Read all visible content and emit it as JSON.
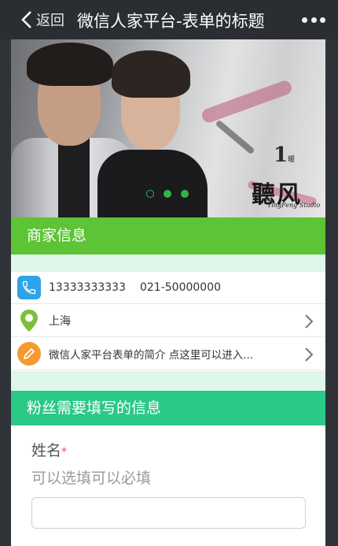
{
  "nav": {
    "back_label": "返回",
    "title": "微信人家平台-表单的标题"
  },
  "banner": {
    "studio_number": "1",
    "studio_number_suffix": "暖",
    "studio_name": "聽风",
    "studio_subtitle": "TingFeng Studio",
    "slide_count": 3,
    "active_slide": 2
  },
  "shop": {
    "header": "商家信息",
    "phone_mobile": "13333333333",
    "phone_landline": "021-50000000",
    "location": "上海",
    "intro": "微信人家平台表单的简介 点这里可以进入..."
  },
  "fans": {
    "header": "粉丝需要填写的信息",
    "name_label": "姓名",
    "required_mark": "*",
    "hint": "可以选填可以必填",
    "name_value": ""
  },
  "colors": {
    "shop_header": "#5cc435",
    "fans_header": "#2ac986",
    "phone_icon": "#2fa3e6",
    "location_icon": "#7bbf3a",
    "pencil_icon": "#f39a32",
    "navbar": "#2a2d31"
  },
  "icons": {
    "back": "chevron-left-icon",
    "more": "more-dots-icon",
    "phone": "phone-icon",
    "location": "map-pin-icon",
    "intro": "pencil-icon",
    "row_arrow": "chevron-right-icon"
  }
}
